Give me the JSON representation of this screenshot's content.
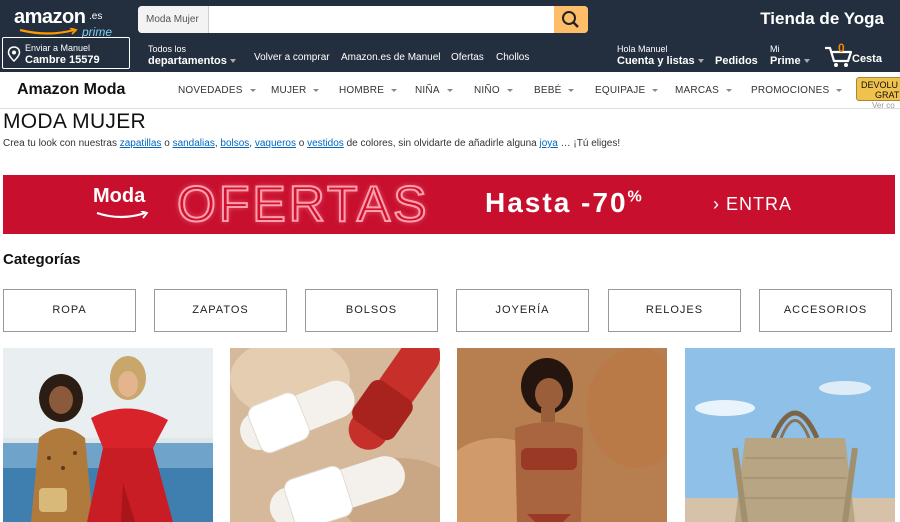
{
  "topnav": {
    "logo_word": "amazon",
    "logo_tld": ".es",
    "logo_prime": "prime",
    "search_category": "Moda Mujer",
    "search_value": "",
    "store_title": "Tienda de Yoga",
    "deliver_line1": "Enviar a Manuel",
    "deliver_line2": "Cambre 15579",
    "departments_small": "Todos los",
    "departments_bold": "departamentos",
    "links": [
      "Volver a comprar",
      "Amazon.es de Manuel",
      "Ofertas",
      "Chollos"
    ],
    "account_small": "Hola Manuel",
    "account_bold": "Cuenta y listas",
    "orders": "Pedidos",
    "prime_small": "Mi",
    "prime_bold": "Prime",
    "cart_count": "0",
    "cart_label": "Cesta"
  },
  "subnav": {
    "brand": "Amazon Moda",
    "items": [
      "NOVEDADES",
      "MUJER",
      "HOMBRE",
      "NIÑA",
      "NIÑO",
      "BEBÉ",
      "EQUIPAJE",
      "MARCAS",
      "PROMOCIONES"
    ],
    "devol_line1": "DEVOLU",
    "devol_line2": "GRATU",
    "ver_condiciones": "Ver co"
  },
  "main": {
    "title": "MODA MUJER",
    "intro_prefix": "Crea tu look con nuestras ",
    "intro_links": [
      "zapatillas",
      "sandalias",
      "bolsos",
      "vaqueros",
      "vestidos",
      "joya"
    ],
    "intro_sep_o": " o ",
    "intro_sep_comma": ", ",
    "intro_middle": " de colores, sin olvidarte de añadirle alguna ",
    "intro_suffix": " … ¡Tú eliges!"
  },
  "banner": {
    "moda": "Moda",
    "ofertas": "OFERTAS",
    "hasta": "Hasta -70",
    "percent": "%",
    "entra": "› ENTRA"
  },
  "categories": {
    "title": "Categorías",
    "items": [
      "ROPA",
      "ZAPATOS",
      "BOLSOS",
      "JOYERÍA",
      "RELOJES",
      "ACCESORIOS"
    ]
  },
  "colors": {
    "nav_bg": "#232f3e",
    "search_btn": "#febd69",
    "banner_red": "#c8102e",
    "link_blue": "#0066c0",
    "cart_orange": "#f08804"
  }
}
